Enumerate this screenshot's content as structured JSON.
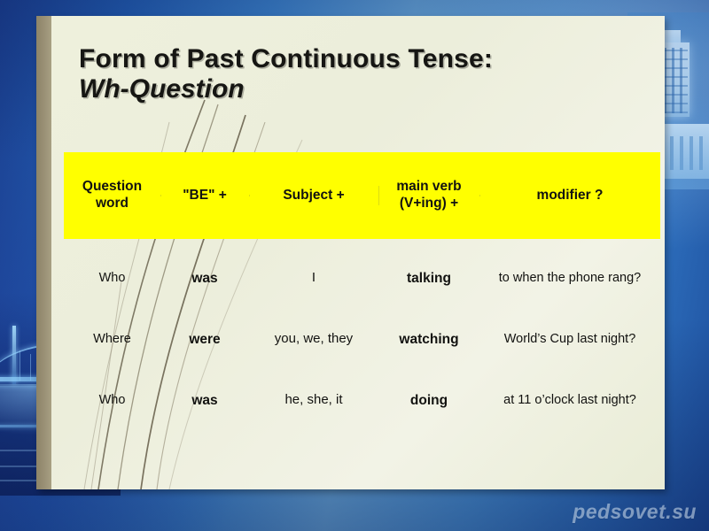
{
  "slide": {
    "title_line1": "Form of Past Continuous Tense:",
    "title_line2": "Wh-Question"
  },
  "table": {
    "headers": [
      "Question word",
      "\"BE\"  +",
      "Subject +",
      "main verb (V+ing) +",
      "modifier ?"
    ],
    "headers_split": {
      "col0_line1": "Question",
      "col0_line2": "word",
      "col3_line1": "main verb",
      "col3_line2": "(V+ing) +"
    },
    "rows": [
      {
        "question_word": "Who",
        "be": "was",
        "subject": "I",
        "main_verb": "talking",
        "modifier": "to when the phone rang?"
      },
      {
        "question_word": "Where",
        "be": "were",
        "subject": "you, we, they",
        "main_verb": "watching",
        "modifier": "World’s Cup last night?"
      },
      {
        "question_word": "Who",
        "be": "was",
        "subject": "he, she, it",
        "main_verb": "doing",
        "modifier": "at 11 o’clock last night?"
      }
    ]
  },
  "watermark": {
    "text": "pedsovet.su"
  },
  "colors": {
    "header_band": "#ffff00",
    "slide_paper": "#eceedb",
    "left_bar": "#9a9176",
    "background_blue": "#2360b4",
    "text": "#121210"
  }
}
